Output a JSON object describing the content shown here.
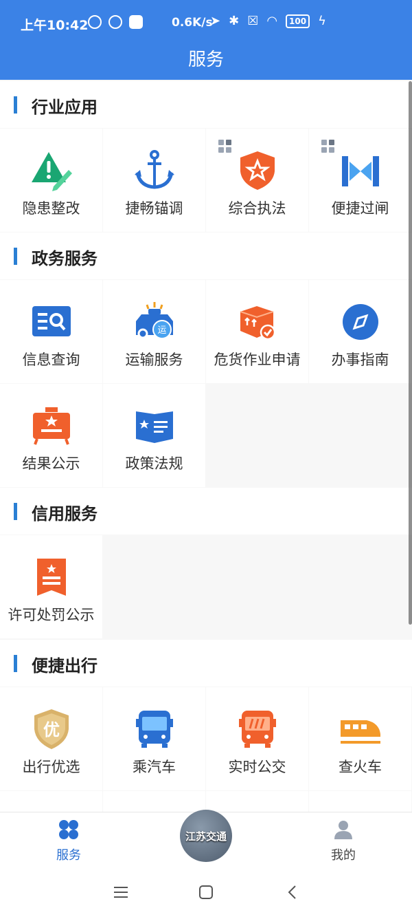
{
  "status": {
    "time": "上午10:42",
    "speed": "0.6K/s",
    "battery": "100"
  },
  "header": {
    "title": "服务"
  },
  "sections": [
    {
      "title": "行业应用",
      "items": [
        {
          "label": "隐患整改",
          "icon": "warning-pencil-icon"
        },
        {
          "label": "捷畅锚调",
          "icon": "anchor-icon"
        },
        {
          "label": "综合执法",
          "icon": "police-badge-icon"
        },
        {
          "label": "便捷过闸",
          "icon": "lock-gate-icon"
        }
      ]
    },
    {
      "title": "政务服务",
      "items": [
        {
          "label": "信息查询",
          "icon": "search-book-icon"
        },
        {
          "label": "运输服务",
          "icon": "transport-car-icon"
        },
        {
          "label": "危货作业申请",
          "icon": "cargo-box-icon"
        },
        {
          "label": "办事指南",
          "icon": "compass-icon"
        },
        {
          "label": "结果公示",
          "icon": "board-star-icon"
        },
        {
          "label": "政策法规",
          "icon": "policy-book-icon"
        }
      ]
    },
    {
      "title": "信用服务",
      "items": [
        {
          "label": "许可处罚公示",
          "icon": "notice-ribbon-icon"
        }
      ]
    },
    {
      "title": "便捷出行",
      "items": [
        {
          "label": "出行优选",
          "icon": "shield-you-icon",
          "glyph": "优"
        },
        {
          "label": "乘汽车",
          "icon": "bus-icon"
        },
        {
          "label": "实时公交",
          "icon": "realtime-bus-icon"
        },
        {
          "label": "查火车",
          "icon": "train-icon"
        }
      ]
    }
  ],
  "nav": {
    "service": "服务",
    "center": "江苏交通",
    "mine": "我的"
  },
  "colors": {
    "header": "#3b82e6",
    "accent": "#2a7fd4"
  }
}
